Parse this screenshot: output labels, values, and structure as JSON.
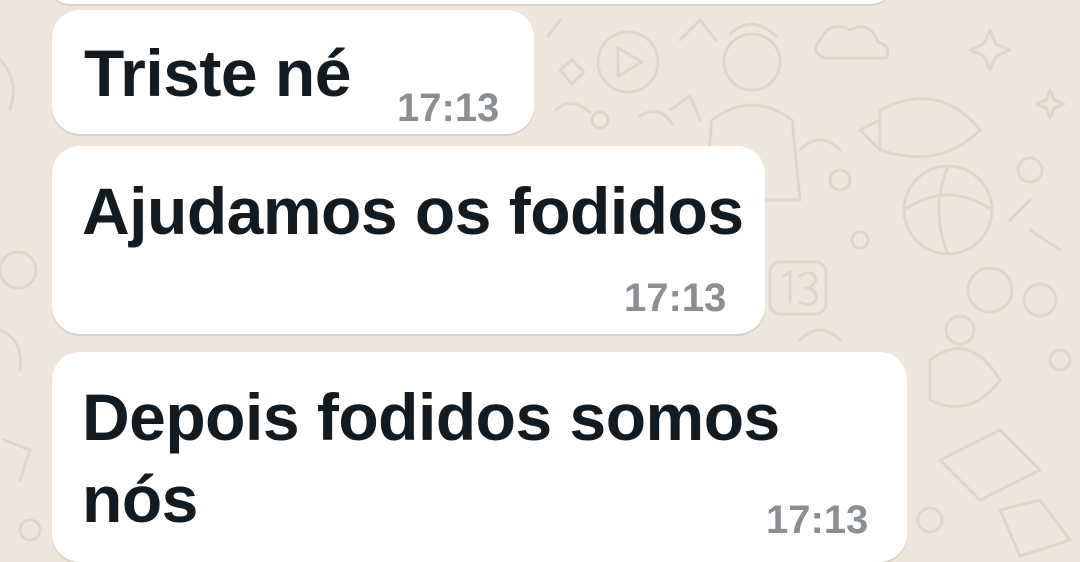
{
  "chat": {
    "messages": [
      {
        "text": "Triste né",
        "time": "17:13"
      },
      {
        "text": "Ajudamos os fodidos",
        "time": "17:13"
      },
      {
        "text_line1": "Depois fodidos somos",
        "text_line2": "nós",
        "time": "17:13"
      }
    ]
  },
  "colors": {
    "wallpaper": "#efe7dd",
    "bubble": "#ffffff",
    "text": "#111b21",
    "timestamp": "#8a8f93"
  }
}
